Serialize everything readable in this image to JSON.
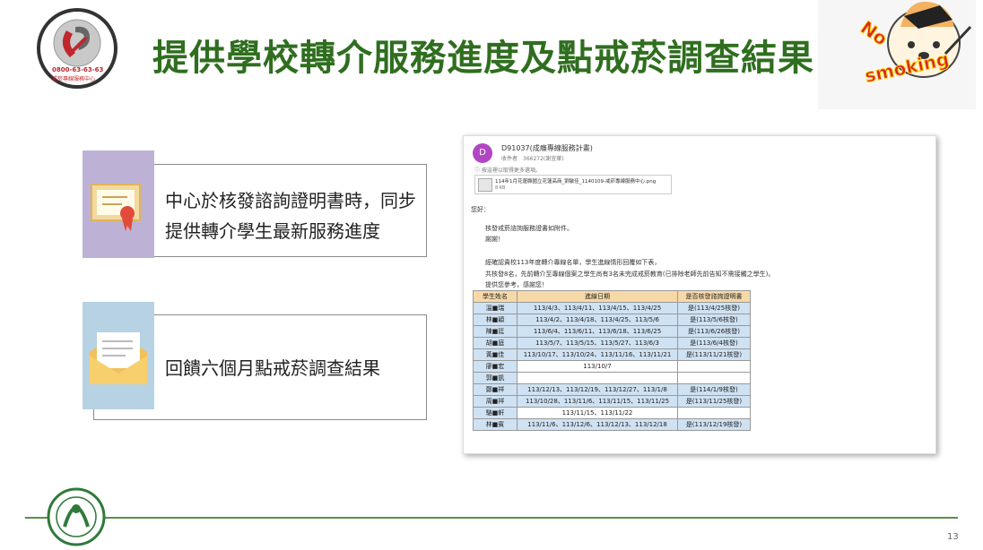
{
  "title": "提供學校轉介服務進度及點戒菸調查結果",
  "hotline_logo": {
    "number": "0800-63-63-63",
    "caption": "戒菸專線服務中心"
  },
  "nosmoking_logo": {
    "text": "No smoking"
  },
  "cards": [
    {
      "icon": "certificate-icon",
      "text": "中心於核發諮詢證明書時，同步提供轉介學生最新服務進度"
    },
    {
      "icon": "envelope-icon",
      "text": "回饋六個月點戒菸調查結果"
    }
  ],
  "email": {
    "avatar_letter": "D",
    "sender": "D91037(成癮專線服務計畫)",
    "recipient": "收件者　366272(謝宜華)",
    "notice": "ⓘ 按這裡以取得更多選項。",
    "attachment_name": "114年1月花蓮縣國立花蓮高商_劉敏佳_1140109-戒菸專線服務中心.png",
    "attachment_size": "8 KB",
    "greeting": "您好：",
    "body_lines": [
      "核發戒菸諮詢服務證書如附件。",
      "謝謝！",
      "",
      "經確認貴校113年度轉介專線名單，學生進線情形回覆如下表，",
      "共核發8名，先前轉介至專線個案之學生尚有3名未完成戒菸教育(已排除老師先前告知不需接觸之學生)。",
      "提供您參考，感謝您！"
    ],
    "table": {
      "headers": [
        "學生姓名",
        "進線日期",
        "是否核發諮詢證明書"
      ],
      "rows": [
        {
          "name": "溫■瑞",
          "dates": "113/4/3、113/4/11、113/4/15、113/4/25",
          "status": "是(113/4/25核發)",
          "hl": true
        },
        {
          "name": "林■穎",
          "dates": "113/4/2、113/4/18、113/4/25、113/5/6",
          "status": "是(113/5/6核發)",
          "hl": true
        },
        {
          "name": "陳■廷",
          "dates": "113/6/4、113/6/11、113/6/18、113/6/25",
          "status": "是(113/6/26核發)",
          "hl": true
        },
        {
          "name": "胡■庭",
          "dates": "113/5/7、113/5/15、113/5/27、113/6/3",
          "status": "是(113/6/4核發)",
          "hl": true
        },
        {
          "name": "黃■佳",
          "dates": "113/10/17、113/10/24、113/11/16、113/11/21",
          "status": "是(113/11/21核發)",
          "hl": true
        },
        {
          "name": "廖■宏",
          "dates": "113/10/7",
          "status": "",
          "hl": false
        },
        {
          "name": "郭■凱",
          "dates": "",
          "status": "",
          "hl": false
        },
        {
          "name": "鄭■祥",
          "dates": "113/12/13、113/12/19、113/12/27、113/1/8",
          "status": "是(114/1/9核發)",
          "hl": true
        },
        {
          "name": "周■祥",
          "dates": "113/10/28、113/11/6、113/11/15、113/11/25",
          "status": "是(113/11/25核發)",
          "hl": true
        },
        {
          "name": "駱■軒",
          "dates": "113/11/15、113/11/22",
          "status": "",
          "hl": false
        },
        {
          "name": "林■賓",
          "dates": "113/11/6、113/12/6、113/12/13、113/12/18",
          "status": "是(113/12/19核發)",
          "hl": true
        }
      ]
    }
  },
  "page_number": "13"
}
